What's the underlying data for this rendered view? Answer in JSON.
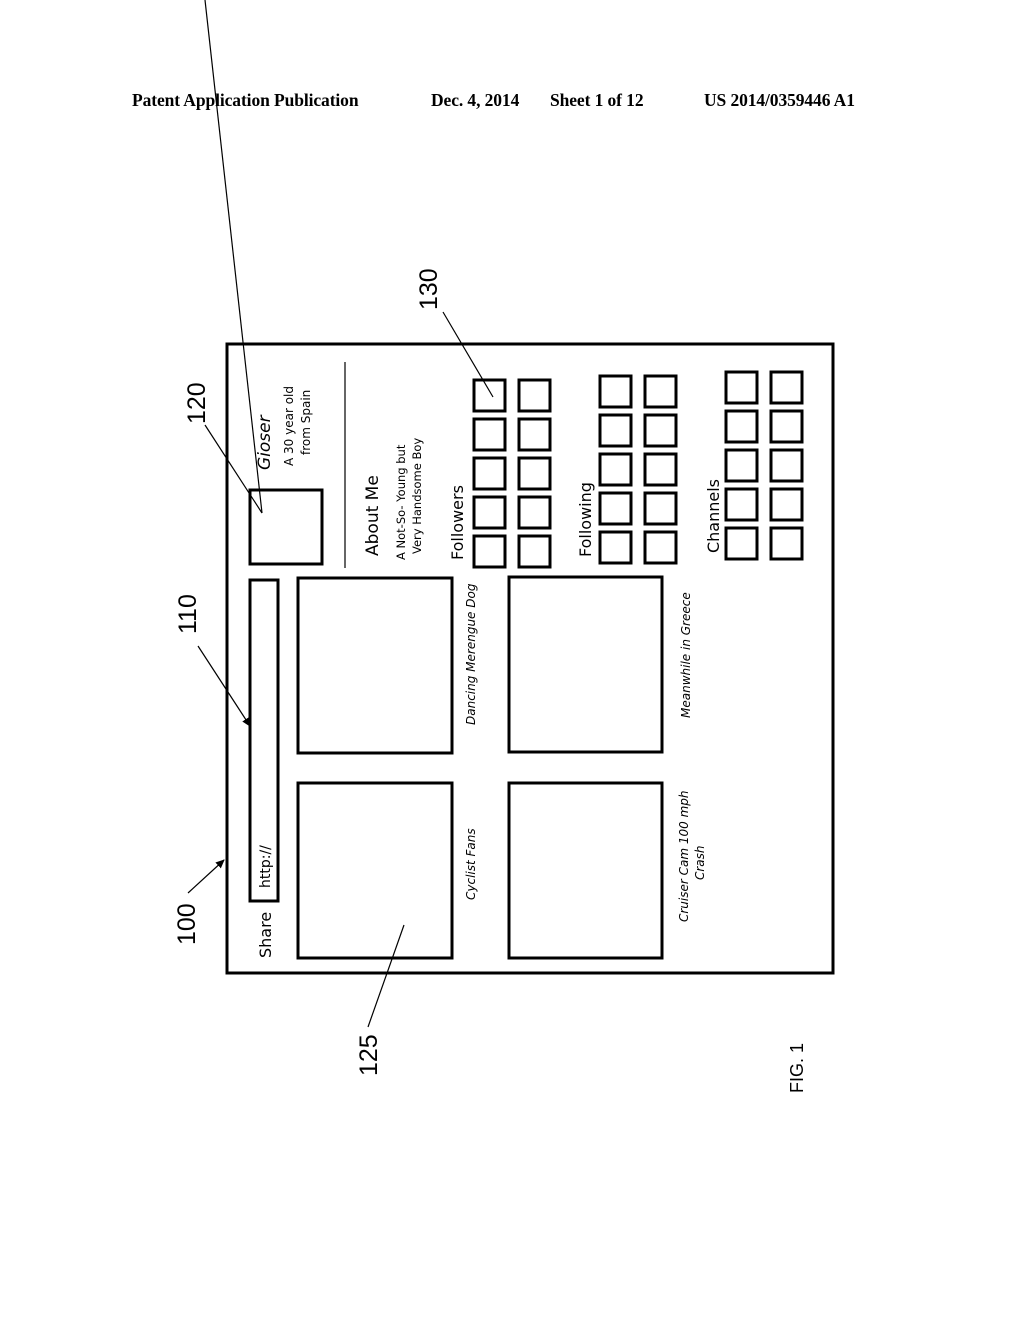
{
  "header": {
    "publication": "Patent Application Publication",
    "date": "Dec. 4, 2014",
    "sheet": "Sheet 1 of 12",
    "number": "US 2014/0359446 A1"
  },
  "figure": {
    "label": "FIG. 1",
    "refs": {
      "screen": "100",
      "share_bar": "110",
      "profile": "120",
      "video_tile": "125",
      "avatar_grid": "130"
    },
    "profile": {
      "name": "Gioser",
      "bio_line1": "A 30 year old",
      "bio_line2": "from Spain",
      "about_heading": "About Me",
      "about_line1": "A Not-So- Young but",
      "about_line2": "Very Handsome Boy"
    },
    "share": {
      "label": "Share",
      "url_value": "http://"
    },
    "videos": [
      {
        "title": "Cyclist Fans"
      },
      {
        "title": "Dancing Merengue Dog"
      },
      {
        "title_line1": "Cruiser Cam 100 mph",
        "title_line2": "Crash"
      },
      {
        "title": "Meanwhile in Greece"
      }
    ],
    "sections": [
      {
        "title": "Followers",
        "count": 10
      },
      {
        "title": "Following",
        "count": 10
      },
      {
        "title": "Channels",
        "count": 10
      }
    ]
  }
}
